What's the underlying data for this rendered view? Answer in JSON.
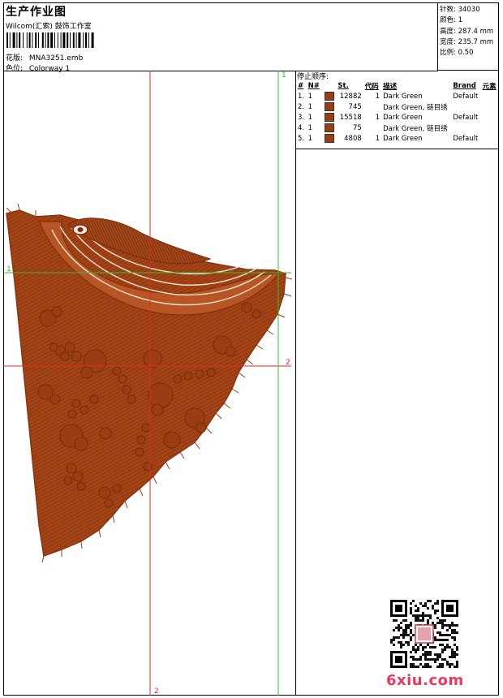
{
  "header": {
    "title": "生产作业图",
    "company": "Wilcom(汇索) 鼓饰工作室",
    "pattern_label": "花版:",
    "pattern_value": "MNA3251.emb",
    "colorway_label": "色位:",
    "colorway_value": "Colorway 1"
  },
  "stats": {
    "stitches": "针数: 34030",
    "colors": "颜色: 1",
    "height": "高度: 287.4 mm",
    "width": "宽度: 235.7 mm",
    "scale": "比例: 0.50"
  },
  "guides": {
    "v1_label": "1",
    "v2_label": "2",
    "h1_label": "1",
    "h2_label": "2",
    "red_v_color": "#e8262b",
    "green_v_color": "#2ec32e"
  },
  "design_color": "#9b3d12",
  "sequence": {
    "title": "停止顺序:",
    "headers": [
      "#",
      "N#",
      "",
      "St.",
      "代码",
      "描述",
      "Brand",
      "元素"
    ],
    "rows": [
      {
        "idx": "1.",
        "n": "1",
        "color": "#9b3d12",
        "st": "12882",
        "code": "1",
        "desc": "Dark Green",
        "brand": "Default"
      },
      {
        "idx": "2.",
        "n": "1",
        "color": "#9b3d12",
        "st": "745",
        "code": "",
        "desc": "Dark  Green, 链目绣",
        "brand": ""
      },
      {
        "idx": "3.",
        "n": "1",
        "color": "#9b3d12",
        "st": "15518",
        "code": "1",
        "desc": "Dark Green",
        "brand": "Default"
      },
      {
        "idx": "4.",
        "n": "1",
        "color": "#9b3d12",
        "st": "75",
        "code": "",
        "desc": "Dark  Green, 链目绣",
        "brand": ""
      },
      {
        "idx": "5.",
        "n": "1",
        "color": "#9b3d12",
        "st": "4808",
        "code": "1",
        "desc": "Dark Green",
        "brand": "Default"
      }
    ]
  },
  "watermark": {
    "text": "6xiu.com",
    "color": "#e83a5c"
  }
}
